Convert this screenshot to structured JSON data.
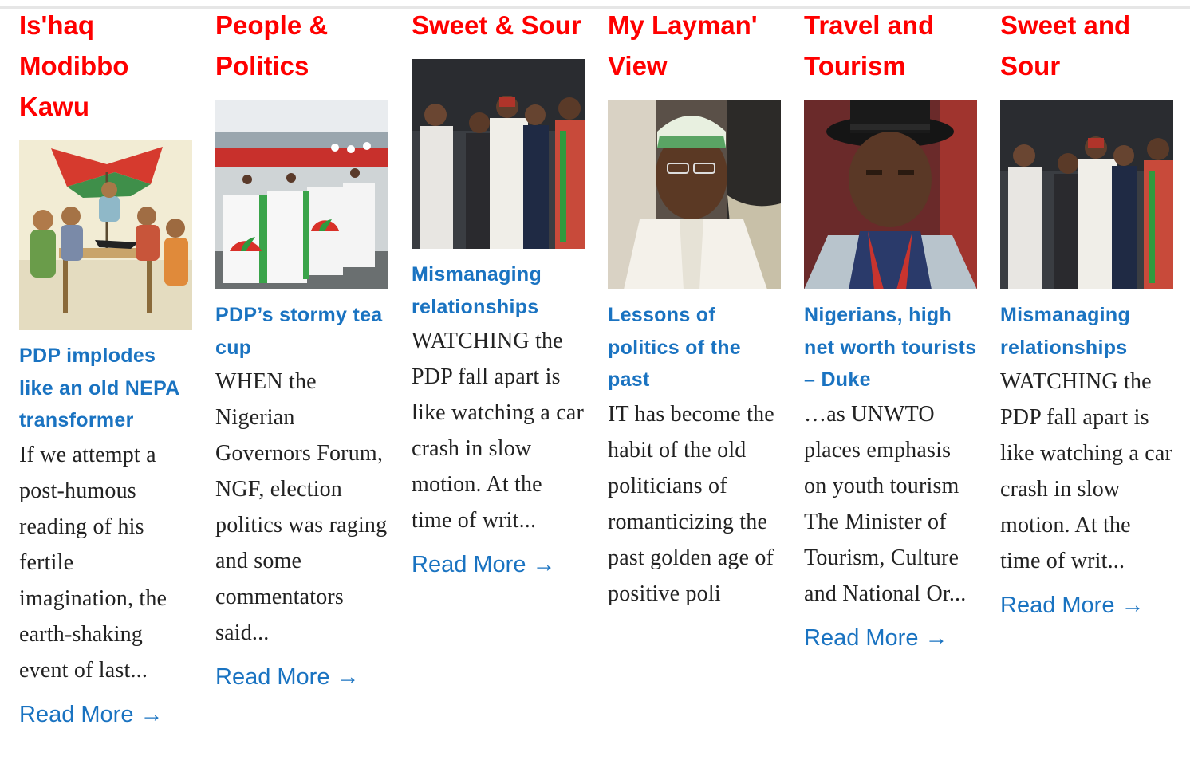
{
  "columns": [
    {
      "heading": "Is'haq Modibbo Kawu",
      "title": "PDP implodes like an old NEPA transformer",
      "excerpt": "If we attempt a post-humous reading of his fertile imagination, the earth-shaking event of last...",
      "read_more": "Read More →",
      "image": "cartoon-illustration"
    },
    {
      "heading": "People & Politics",
      "title": "PDP’s stormy tea cup",
      "excerpt": "WHEN the Nigerian Governors Forum, NGF, election politics was raging and some commentators said...",
      "read_more": "Read More →",
      "image": "convention-booths-photo"
    },
    {
      "heading": "Sweet & Sour",
      "title": "Mismanaging relationships",
      "excerpt": "WATCHING the PDP fall apart is like watching a car crash in slow motion. At the  time of writ...",
      "read_more": "Read More →",
      "image": "politicians-group-photo"
    },
    {
      "heading": "My Layman' View",
      "title": "Lessons of politics of the past",
      "excerpt": "IT has become the habit of the old politicians of romanticizing the past golden age of positive poli",
      "read_more": "",
      "image": "politician-portrait-photo"
    },
    {
      "heading": "Travel and Tourism",
      "title": "Nigerians, high net worth tourists – Duke",
      "excerpt": "…as UNWTO places emphasis on youth tourism The Minister of Tourism, Culture and National Or...",
      "read_more": "Read More →",
      "image": "minister-portrait-photo"
    },
    {
      "heading": "Sweet and Sour",
      "title": "Mismanaging relationships",
      "excerpt": "WATCHING the PDP fall apart is like watching a car crash in slow motion. At the  time of writ...",
      "read_more": "Read More →",
      "image": "politicians-group-photo"
    }
  ],
  "colors": {
    "heading": "#ff0000",
    "link": "#1a73c1",
    "text": "#222222"
  }
}
